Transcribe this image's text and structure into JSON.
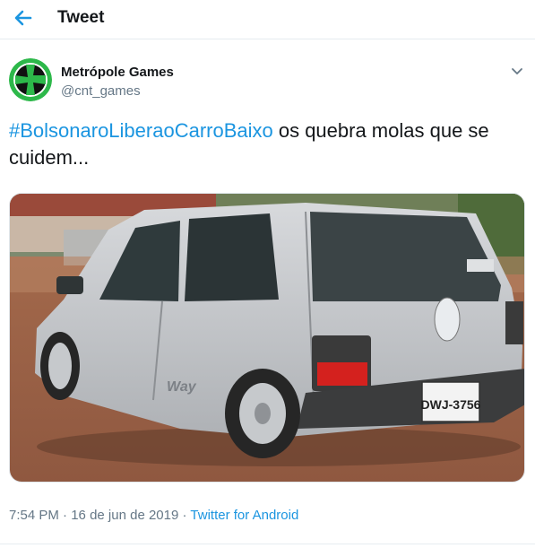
{
  "header": {
    "title": "Tweet",
    "back_icon": "arrow-left-icon"
  },
  "author": {
    "name": "Metrópole Games",
    "handle": "@cnt_games",
    "avatar_icon": "green-cross-logo"
  },
  "tweet": {
    "hashtag": "#BolsonaroLiberaoCarroBaixo",
    "text": " os quebra molas que se cuidem..."
  },
  "media": {
    "plate": "DWJ-3756",
    "badge": "Way"
  },
  "meta": {
    "time": "7:54 PM",
    "sep1": " · ",
    "date": "16 de jun de 2019",
    "sep2": " · ",
    "source": "Twitter for Android"
  },
  "colors": {
    "accent": "#1b95e0",
    "text": "#14171a",
    "muted": "#657786",
    "logo": "#2db84a"
  }
}
